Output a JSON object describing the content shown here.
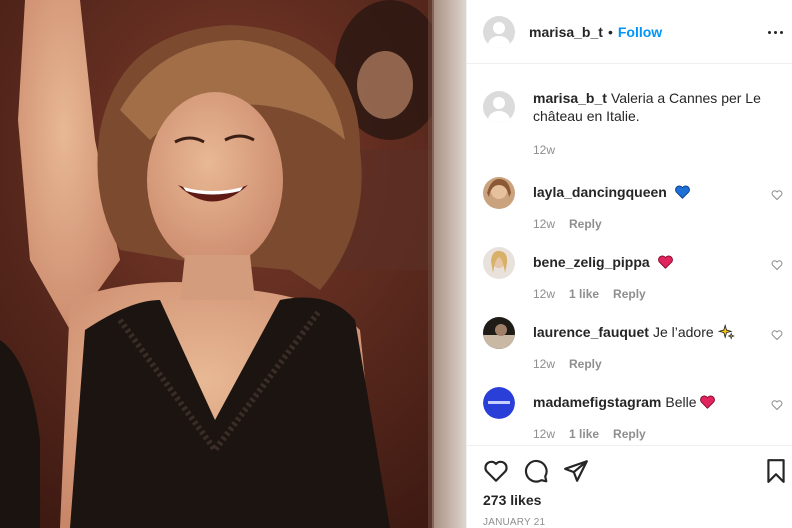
{
  "header": {
    "username": "marisa_b_t",
    "separator": "•",
    "follow_label": "Follow"
  },
  "caption": {
    "username": "marisa_b_t",
    "text": "Valeria a Cannes per Le château en Italie.",
    "age": "12w"
  },
  "comments": [
    {
      "username": "layla_dancingqueen",
      "text": "",
      "emoji": "💙",
      "age": "12w",
      "likes": "",
      "reply": "Reply",
      "emoji_color": "#1e6fd6"
    },
    {
      "username": "bene_zelig_pippa",
      "text": "",
      "emoji": "❤️",
      "age": "12w",
      "likes": "1 like",
      "reply": "Reply",
      "emoji_color": "#e0245e"
    },
    {
      "username": "laurence_fauquet",
      "text": "Je l’adore",
      "emoji": "✨",
      "age": "12w",
      "likes": "",
      "reply": "Reply",
      "emoji_color": "#f5c518"
    },
    {
      "username": "madamefigstagram",
      "text": "Belle",
      "emoji": "❤️",
      "age": "12w",
      "likes": "1 like",
      "reply": "Reply",
      "emoji_color": "#e0245e"
    }
  ],
  "footer": {
    "likes": "273 likes",
    "date": "JANUARY 21"
  },
  "colors": {
    "link_blue": "#0095f6",
    "muted": "#8e8e8e",
    "text": "#262626",
    "border": "#efefef"
  },
  "icons": [
    "more-icon",
    "heart-icon",
    "comment-icon",
    "share-icon",
    "bookmark-icon"
  ]
}
